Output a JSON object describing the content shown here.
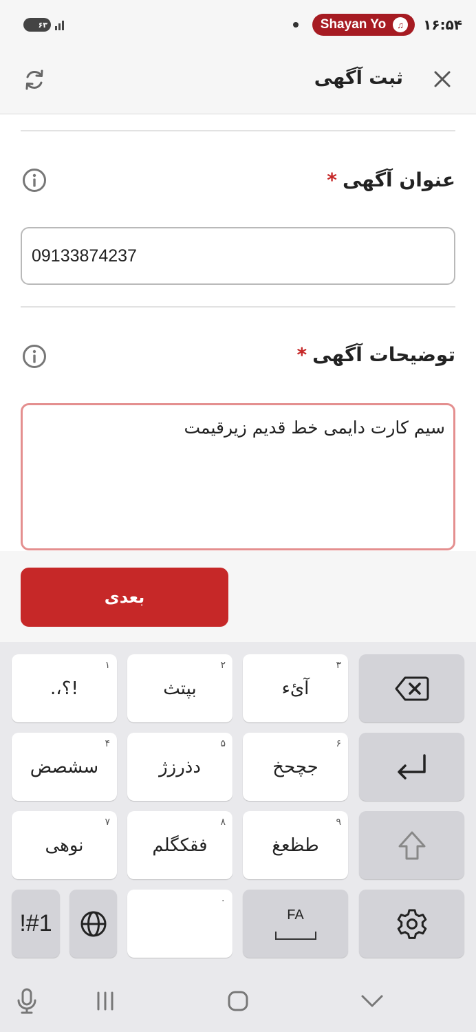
{
  "status_bar": {
    "battery": "۶۳",
    "media_label": "Shayan Yo",
    "time": "۱۶:۵۴"
  },
  "app_bar": {
    "title": "ثبت آگهی",
    "close_icon": "close-icon",
    "refresh_icon": "refresh-icon"
  },
  "form": {
    "title_field": {
      "label": "عنوان آگهی",
      "required_mark": "*",
      "value": "09133874237"
    },
    "description_field": {
      "label": "توضیحات آگهی",
      "required_mark": "*",
      "value": "سیم کارت دایمی خط قدیم زیرقیمت"
    }
  },
  "next_button": {
    "label": "بعدی",
    "color": "#c62828"
  },
  "keyboard": {
    "rows": [
      [
        {
          "num": "۱",
          "letters": "!؟،."
        },
        {
          "num": "۲",
          "letters": "بپتث"
        },
        {
          "num": "۳",
          "letters": "آئء"
        }
      ],
      [
        {
          "num": "۴",
          "letters": "سشصض"
        },
        {
          "num": "۵",
          "letters": "دذرزژ"
        },
        {
          "num": "۶",
          "letters": "جچحخ"
        }
      ],
      [
        {
          "num": "۷",
          "letters": "نوهی"
        },
        {
          "num": "۸",
          "letters": "فقکگلم"
        },
        {
          "num": "۹",
          "letters": "طظعغ"
        }
      ]
    ],
    "symbols_label": "!#1",
    "space_hint": "۰",
    "language_label": "FA"
  },
  "colors": {
    "accent": "#c62828",
    "error_border": "#e48f8f",
    "media_pill": "#a61b22"
  }
}
